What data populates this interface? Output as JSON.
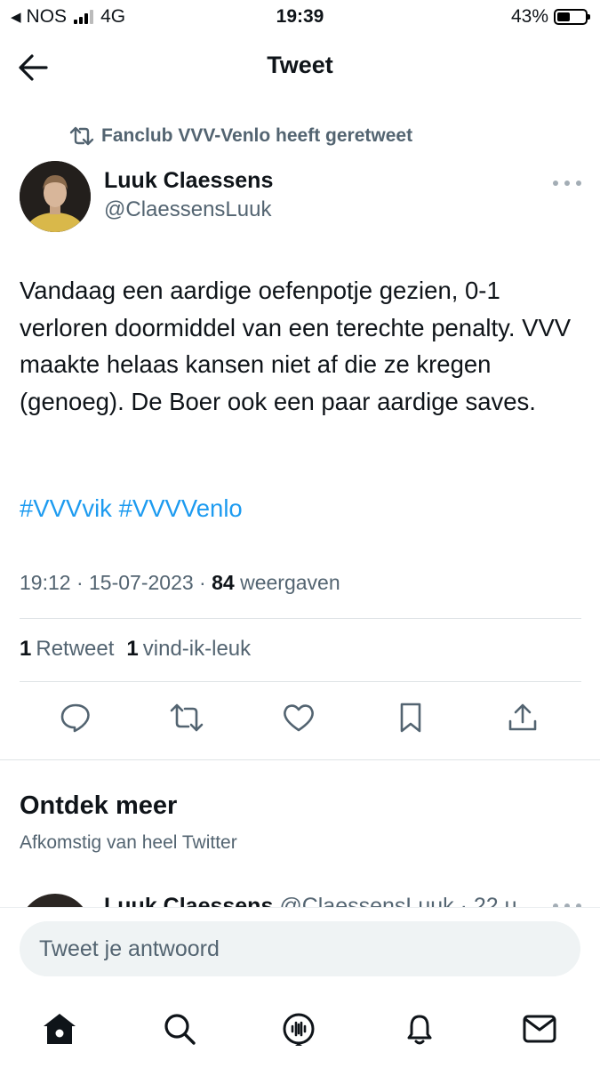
{
  "status_bar": {
    "carrier": "NOS",
    "network": "4G",
    "time": "19:39",
    "battery": "43%"
  },
  "header": {
    "title": "Tweet",
    "back_icon": "arrow-left-icon"
  },
  "retweet_context": {
    "icon": "retweet-icon",
    "text": "Fanclub VVV-Venlo heeft geretweet"
  },
  "tweet": {
    "author_name": "Luuk Claessens",
    "author_handle": "@ClaessensLuuk",
    "text": "Vandaag een aardige oefenpotje gezien, 0-1 verloren doormiddel van een terechte penalty. VVV maakte helaas kansen niet af die ze kregen (genoeg). De Boer ook een paar aardige saves.",
    "hashtags": [
      "#VVVvik",
      "#VVVVenlo"
    ],
    "time": "19:12",
    "date": "15-07-2023",
    "views_count": "84",
    "views_label": "weergaven",
    "retweets_count": "1",
    "retweets_label": "Retweet",
    "likes_count": "1",
    "likes_label": "vind-ik-leuk"
  },
  "actions": [
    "reply-icon",
    "retweet-icon",
    "like-icon",
    "bookmark-icon",
    "share-icon"
  ],
  "discover": {
    "title": "Ontdek meer",
    "subtitle": "Afkomstig van heel Twitter",
    "peek_name": "Luuk Claessens",
    "peek_handle": "@ClaessensLuuk · 22 u"
  },
  "reply": {
    "placeholder": "Tweet je antwoord"
  },
  "bottom_nav": [
    "home-icon",
    "search-icon",
    "spaces-icon",
    "notifications-icon",
    "messages-icon"
  ],
  "colors": {
    "accent": "#1d9bf0",
    "secondary_text": "#536471",
    "primary_text": "#0f1419"
  }
}
